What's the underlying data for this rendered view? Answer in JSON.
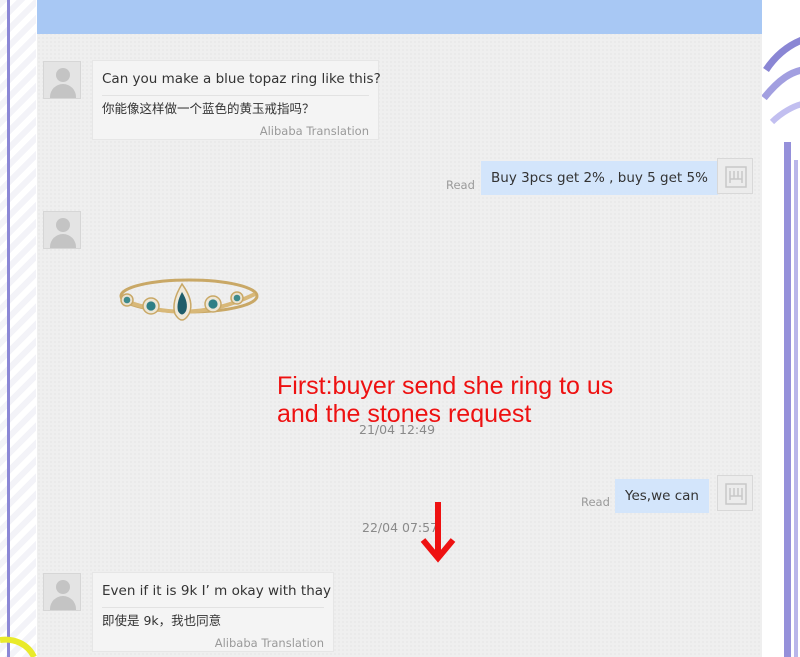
{
  "messages": [
    {
      "id": "m1",
      "direction": "incoming",
      "text_en": "Can you make a blue topaz ring like this?",
      "text_zh": "你能像这样做一个蓝色的黄玉戒指吗？",
      "translation_label": "Alibaba Translation"
    },
    {
      "id": "m2",
      "direction": "outgoing",
      "status": "Read",
      "text": "Buy 3pcs get 2% , buy 5 get 5%"
    },
    {
      "id": "m3",
      "direction": "incoming",
      "type": "image",
      "image_subject": "gold ring with pear-cut blue topaz center stone and round blue side stones"
    },
    {
      "id": "m4",
      "direction": "outgoing",
      "status": "Read",
      "text": "Yes,we can"
    },
    {
      "id": "m5",
      "direction": "incoming",
      "text_en": "Even if it is 9k I’  m okay with thay",
      "text_zh": "即使是 9k，我也同意",
      "translation_label": "Alibaba Translation"
    }
  ],
  "timestamps": {
    "first": "21/04 12:49",
    "second": "22/04 07:57"
  },
  "annotation": {
    "line1": "First:buyer send she ring to us",
    "line2": "and the stones request",
    "color": "#ee1111"
  },
  "colors": {
    "header_bar": "#a8c8f4",
    "outgoing_bubble": "#d3e5fb",
    "incoming_bubble": "#f4f4f4",
    "chat_background": "#efefef",
    "accent_purple": "#9590da"
  }
}
